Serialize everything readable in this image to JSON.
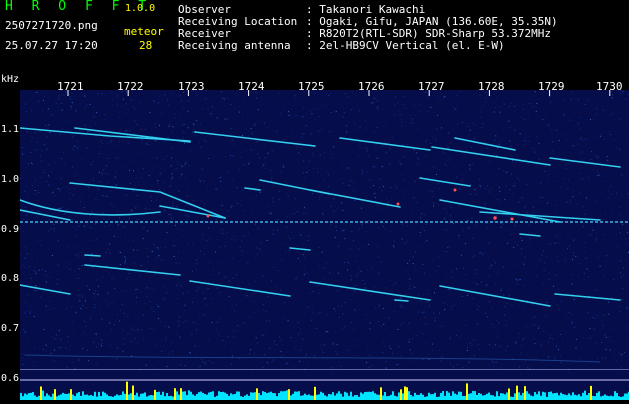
{
  "app": {
    "title": "H R O F F T",
    "version": "1.0.0"
  },
  "capture": {
    "file_name": "2507271720.png",
    "timestamp": "25.07.27 17:20",
    "meteor_label": "meteor",
    "meteor_count": "28"
  },
  "info": {
    "rows": [
      {
        "label": "Observer",
        "value": ": Takanori Kawachi"
      },
      {
        "label": "Receiving Location",
        "value": ": Ogaki, Gifu, JAPAN (136.60E, 35.35N)"
      },
      {
        "label": "Receiver",
        "value": ": R820T2(RTL-SDR) SDR-Sharp 53.372MHz"
      },
      {
        "label": "Receiving antenna",
        "value": ": 2el-HB9CV Vertical (el. E-W)"
      }
    ]
  },
  "axes": {
    "y_unit": "kHz",
    "y_ticks": [
      "1.1",
      "1.0",
      "0.9",
      "0.8",
      "0.7",
      "0.6"
    ],
    "x_ticks": [
      "1721",
      "1722",
      "1723",
      "1724",
      "1725",
      "1726",
      "1727",
      "1728",
      "1729",
      "1730"
    ]
  },
  "colors": {
    "background": "#000000",
    "spectrogram_bg": "#050d4a",
    "trace": "#33d0f0",
    "bright_trace": "#ff5050",
    "amplitude": "#ffff00",
    "amplitude_base": "#00e5ff",
    "title_green": "#00ff00",
    "label_yellow": "#ffff00"
  }
}
